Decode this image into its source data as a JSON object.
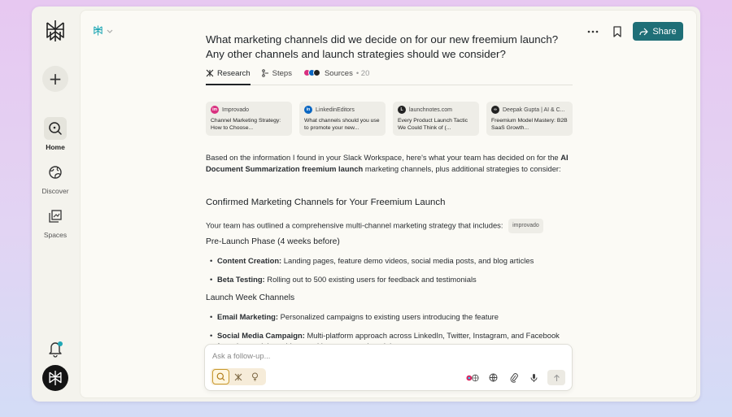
{
  "nav": {
    "home": "Home",
    "discover": "Discover",
    "spaces": "Spaces"
  },
  "header": {
    "share": "Share"
  },
  "thread": {
    "question": "What marketing channels did we decide on for our new freemium launch? Any other channels and launch strategies should we consider?",
    "tabs": {
      "research": "Research",
      "steps": "Steps",
      "sources": "Sources",
      "sources_count": "• 20"
    },
    "sources": [
      {
        "site": "Improvado",
        "title": "Channel Marketing Strategy: How to Choose...",
        "fav_label": "im",
        "fav_color": "#d9307f"
      },
      {
        "site": "LinkedinEditors",
        "title": "What channels should you use to promote your new...",
        "fav_label": "in",
        "fav_color": "#0a66c2"
      },
      {
        "site": "launchnotes.com",
        "title": "Every Product Launch Tactic We Could Think of (...",
        "fav_label": "L",
        "fav_color": "#222222"
      },
      {
        "site": "Deepak Gupta | AI & C...",
        "title": "Freemium Model Mastery: B2B SaaS Growth...",
        "fav_label": "∞",
        "fav_color": "#222222"
      }
    ],
    "intro_pre": "Based on the information I found in your Slack Workspace, here's what your team has decided on for the ",
    "intro_bold": "AI Document Summarization freemium launch",
    "intro_post": " marketing channels, plus additional strategies to consider:",
    "heading_confirmed": "Confirmed Marketing Channels for Your Freemium Launch",
    "outline": "Your team has outlined a comprehensive multi-channel marketing strategy that includes:",
    "outline_pill": "improvado",
    "phase1": "Pre-Launch Phase (4 weeks before)",
    "phase1_items": [
      {
        "label": "Content Creation:",
        "text": " Landing pages, feature demo videos, social media posts, and blog articles"
      },
      {
        "label": "Beta Testing:",
        "text": " Rolling out to 500 existing users for feedback and testimonials"
      }
    ],
    "phase2": "Launch Week Channels",
    "phase2_items": [
      {
        "label": "Email Marketing:",
        "text": " Personalized campaigns to existing users introducing the feature"
      },
      {
        "label": "Social Media Campaign:",
        "text": " Multi-platform approach across LinkedIn, Twitter, Instagram, and Facebook featuring explainer videos and beta user testimonials"
      }
    ]
  },
  "composer": {
    "placeholder": "Ask a follow-up..."
  },
  "colors": {
    "accent": "#1f6f77",
    "mode_active": "#c99a2e"
  }
}
